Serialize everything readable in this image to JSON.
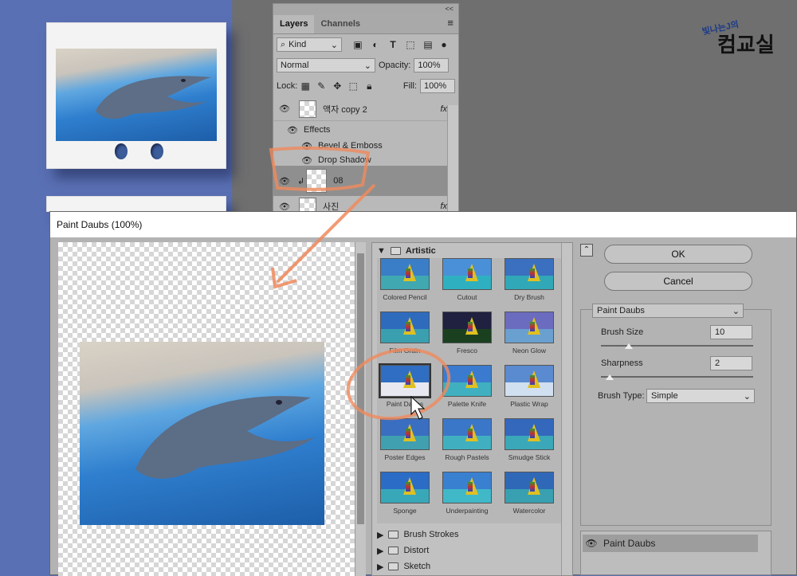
{
  "watermark": {
    "line1": "빛나는J의",
    "line2": "컴교실"
  },
  "layers_panel": {
    "collapse": "<<",
    "tabs": [
      "Layers",
      "Channels"
    ],
    "kind": "Kind",
    "blend_mode": "Normal",
    "opacity_label": "Opacity:",
    "opacity_value": "100%",
    "lock_label": "Lock:",
    "fill_label": "Fill:",
    "fill_value": "100%",
    "layers": [
      {
        "name": "액자 copy 2",
        "fx": "fx"
      },
      {
        "name": "Effects"
      },
      {
        "name": "Bevel & Emboss"
      },
      {
        "name": "Drop Shadow"
      },
      {
        "name": "08"
      },
      {
        "name": "사진",
        "fx": "fx"
      }
    ]
  },
  "dialog": {
    "title": "Paint Daubs (100%)",
    "category_open": "Artistic",
    "filters": [
      "Colored Pencil",
      "Cutout",
      "Dry Brush",
      "Film Grain",
      "Fresco",
      "Neon Glow",
      "Paint Daubs",
      "Palette Knife",
      "Plastic Wrap",
      "Poster Edges",
      "Rough Pastels",
      "Smudge Stick",
      "Sponge",
      "Underpainting",
      "Watercolor"
    ],
    "categories_closed": [
      "Brush Strokes",
      "Distort",
      "Sketch"
    ],
    "ok": "OK",
    "cancel": "Cancel",
    "filter_select": "Paint Daubs",
    "brush_size_label": "Brush Size",
    "brush_size_value": "10",
    "sharpness_label": "Sharpness",
    "sharpness_value": "2",
    "brush_type_label": "Brush Type:",
    "brush_type_value": "Simple",
    "effect_layer": "Paint Daubs"
  },
  "colors": {
    "accent_annotation": "#f08a5d",
    "canvas_blue": "#5a70b4"
  }
}
